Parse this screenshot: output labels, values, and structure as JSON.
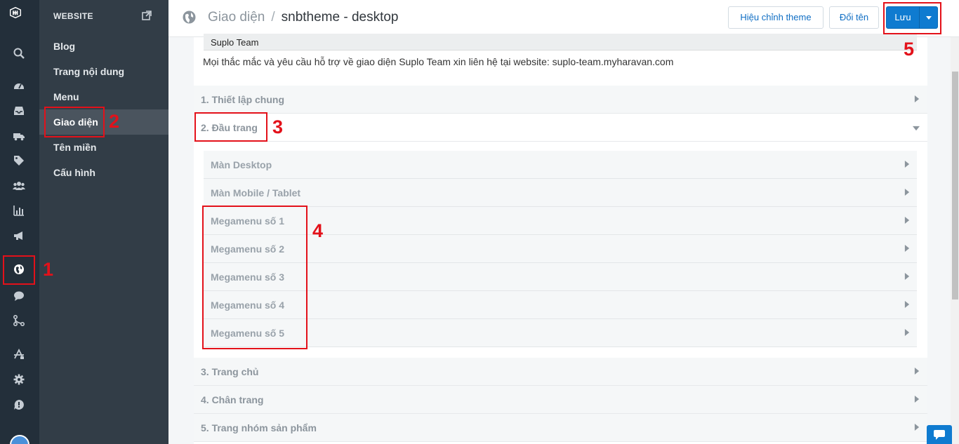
{
  "sub_sidebar": {
    "header": "WEBSITE",
    "items": [
      {
        "label": "Blog"
      },
      {
        "label": "Trang nội dung"
      },
      {
        "label": "Menu"
      },
      {
        "label": "Giao diện"
      },
      {
        "label": "Tên miền"
      },
      {
        "label": "Cấu hình"
      }
    ]
  },
  "rail_icons": [
    "logo",
    "search-icon",
    "dashboard-icon",
    "inbox-icon",
    "truck-icon",
    "tag-icon",
    "users-icon",
    "bar-chart-icon",
    "megaphone-icon",
    "globe-icon",
    "chat-icon",
    "branch-icon",
    "apps-icon",
    "settings-icon",
    "help-icon",
    "avatar"
  ],
  "header": {
    "breadcrumb_parent": "Giao diện",
    "breadcrumb_separator": "/",
    "breadcrumb_current": "snbtheme - desktop",
    "edit_theme_label": "Hiệu chỉnh theme",
    "rename_label": "Đổi tên",
    "save_label": "Lưu"
  },
  "content": {
    "suplo_team_label": "Suplo Team",
    "note": "Mọi thắc mắc và yêu cầu hỗ trợ về giao diện Suplo Team xin liên hệ tại website: suplo-team.myharavan.com",
    "sections": [
      {
        "label": "1. Thiết lập chung"
      },
      {
        "label": "2. Đầu trang"
      },
      {
        "label": "3. Trang chủ"
      },
      {
        "label": "4. Chân trang"
      },
      {
        "label": "5. Trang nhóm sản phẩm"
      }
    ],
    "header_subitems": [
      {
        "label": "Màn Desktop"
      },
      {
        "label": "Màn Mobile / Tablet"
      },
      {
        "label": "Megamenu số 1"
      },
      {
        "label": "Megamenu số 2"
      },
      {
        "label": "Megamenu số 3"
      },
      {
        "label": "Megamenu số 4"
      },
      {
        "label": "Megamenu số 5"
      }
    ]
  },
  "annotations": [
    "1",
    "2",
    "3",
    "4",
    "5"
  ],
  "colors": {
    "rail_bg": "#232f3a",
    "sidebar_bg": "#323d47",
    "primary": "#0f7bd0",
    "annotation_red": "#e3111a"
  }
}
